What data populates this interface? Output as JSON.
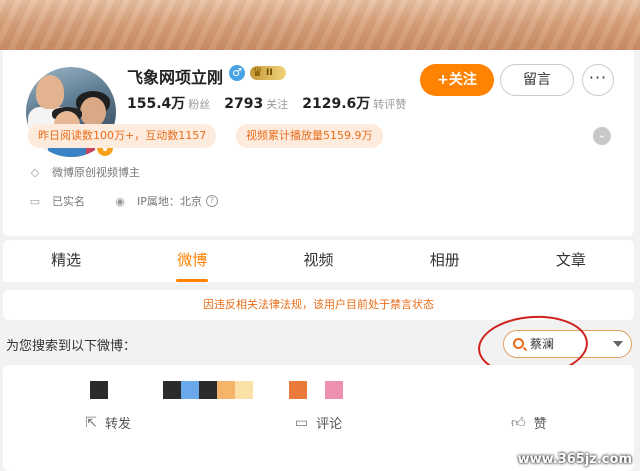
{
  "profile": {
    "name": "飞象网项立刚",
    "level_label": "II",
    "verified_mark": "V",
    "male_symbol": "♂",
    "stats": [
      {
        "value": "155.4万",
        "label": "粉丝"
      },
      {
        "value": "2793",
        "label": "关注"
      },
      {
        "value": "2129.6万",
        "label": "转评赞"
      }
    ],
    "follow_label": "+关注",
    "message_label": "留言",
    "more_label": "···",
    "tags": [
      "昨日阅读数100万+，互动数1157",
      "视频累计播放量5159.9万"
    ],
    "bio": "微博原创视频博主",
    "real_name_label": "已实名",
    "ip_label": "IP属地：北京"
  },
  "tabs": [
    {
      "label": "精选",
      "active": false
    },
    {
      "label": "微博",
      "active": true
    },
    {
      "label": "视频",
      "active": false
    },
    {
      "label": "相册",
      "active": false
    },
    {
      "label": "文章",
      "active": false
    }
  ],
  "notice": "因违反相关法律法规，该用户目前处于禁言状态",
  "search": {
    "label": "为您搜索到以下微博：",
    "value": "蔡澜"
  },
  "post": {
    "censor_colors": [
      "#2b2b2b",
      "#2b2b2b",
      "#6aa8ec",
      "#2b2b2b",
      "#f4b46a",
      "#fbe0a8",
      "#e97a3a",
      "#ec8fb0"
    ],
    "actions": [
      {
        "icon": "share-icon",
        "label": "转发"
      },
      {
        "icon": "comment-icon",
        "label": "评论"
      },
      {
        "icon": "like-icon",
        "label": "赞"
      }
    ]
  },
  "watermark": "www.365jz.com",
  "colors": {
    "accent": "#ff8200",
    "notice": "#e86d1a",
    "annotation": "#d0201c"
  }
}
